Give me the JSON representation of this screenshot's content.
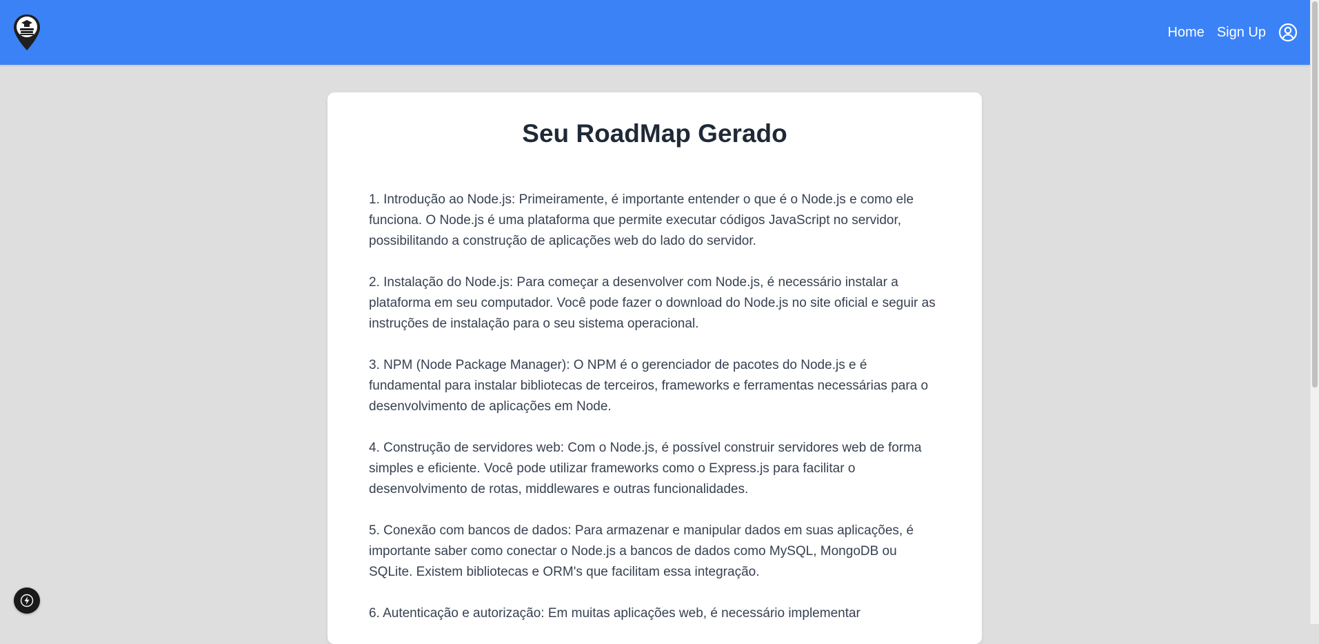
{
  "navbar": {
    "links": {
      "home": "Home",
      "signup": "Sign Up"
    },
    "logo_icon": "map-pin-graduation-cap-icon",
    "user_icon": "user-circle-icon",
    "background_color": "#3b82f6"
  },
  "main": {
    "title": "Seu RoadMap Gerado",
    "steps": [
      "1. Introdução ao Node.js: Primeiramente, é importante entender o que é o Node.js e como ele funciona. O Node.js é uma plataforma que permite executar códigos JavaScript no servidor, possibilitando a construção de aplicações web do lado do servidor.",
      "2. Instalação do Node.js: Para começar a desenvolver com Node.js, é necessário instalar a plataforma em seu computador. Você pode fazer o download do Node.js no site oficial e seguir as instruções de instalação para o seu sistema operacional.",
      "3. NPM (Node Package Manager): O NPM é o gerenciador de pacotes do Node.js e é fundamental para instalar bibliotecas de terceiros, frameworks e ferramentas necessárias para o desenvolvimento de aplicações em Node.",
      "4. Construção de servidores web: Com o Node.js, é possível construir servidores web de forma simples e eficiente. Você pode utilizar frameworks como o Express.js para facilitar o desenvolvimento de rotas, middlewares e outras funcionalidades.",
      "5. Conexão com bancos de dados: Para armazenar e manipular dados em suas aplicações, é importante saber como conectar o Node.js a bancos de dados como MySQL, MongoDB ou SQLite. Existem bibliotecas e ORM's que facilitam essa integração.",
      "6. Autenticação e autorização: Em muitas aplicações web, é necessário implementar"
    ]
  },
  "fab": {
    "icon": "lightning-bolt-icon"
  }
}
